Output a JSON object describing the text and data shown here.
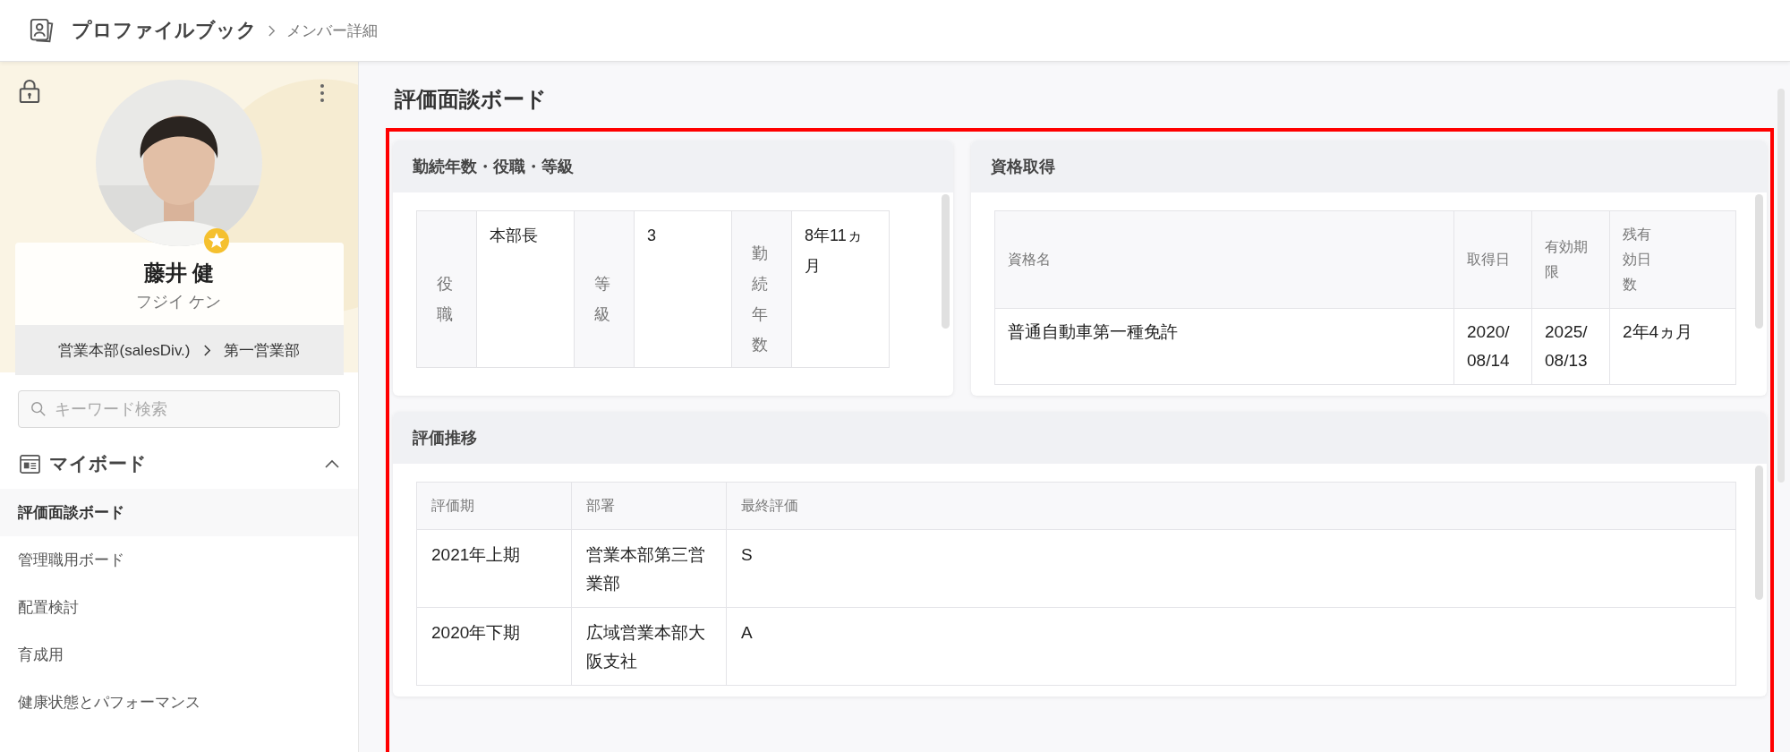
{
  "header": {
    "app_title": "プロファイルブック",
    "breadcrumb": "メンバー詳細"
  },
  "profile": {
    "name": "藤井 健",
    "kana": "フジイ ケン",
    "department": "営業本部(salesDiv.)",
    "team": "第一営業部"
  },
  "search": {
    "placeholder": "キーワード検索"
  },
  "board_section": {
    "title": "マイボード",
    "expanded": true,
    "items": [
      {
        "label": "評価面談ボード",
        "selected": true
      },
      {
        "label": "管理職用ボード",
        "selected": false
      },
      {
        "label": "配置検討",
        "selected": false
      },
      {
        "label": "育成用",
        "selected": false
      },
      {
        "label": "健康状態とパフォーマンス",
        "selected": false
      }
    ]
  },
  "page_title": "評価面談ボード",
  "tenure_card": {
    "title": "勤続年数・役職・等級",
    "fields": [
      {
        "label": "役職",
        "value": "本部長"
      },
      {
        "label": "等級",
        "value": "3"
      },
      {
        "label": "勤続年数",
        "value": "8年11ヵ月"
      }
    ]
  },
  "qualification_card": {
    "title": "資格取得",
    "columns": [
      "資格名",
      "取得日",
      "有効期限",
      "残有効日数"
    ],
    "rows": [
      [
        "普通自動車第一種免許",
        "2020/08/14",
        "2025/08/13",
        "2年4ヵ月"
      ]
    ]
  },
  "evaluation_card": {
    "title": "評価推移",
    "columns": [
      "評価期",
      "部署",
      "最終評価"
    ],
    "rows": [
      [
        "2021年上期",
        "営業本部第三営業部",
        "S"
      ],
      [
        "2020年下期",
        "広域営業本部大阪支社",
        "A"
      ]
    ]
  }
}
